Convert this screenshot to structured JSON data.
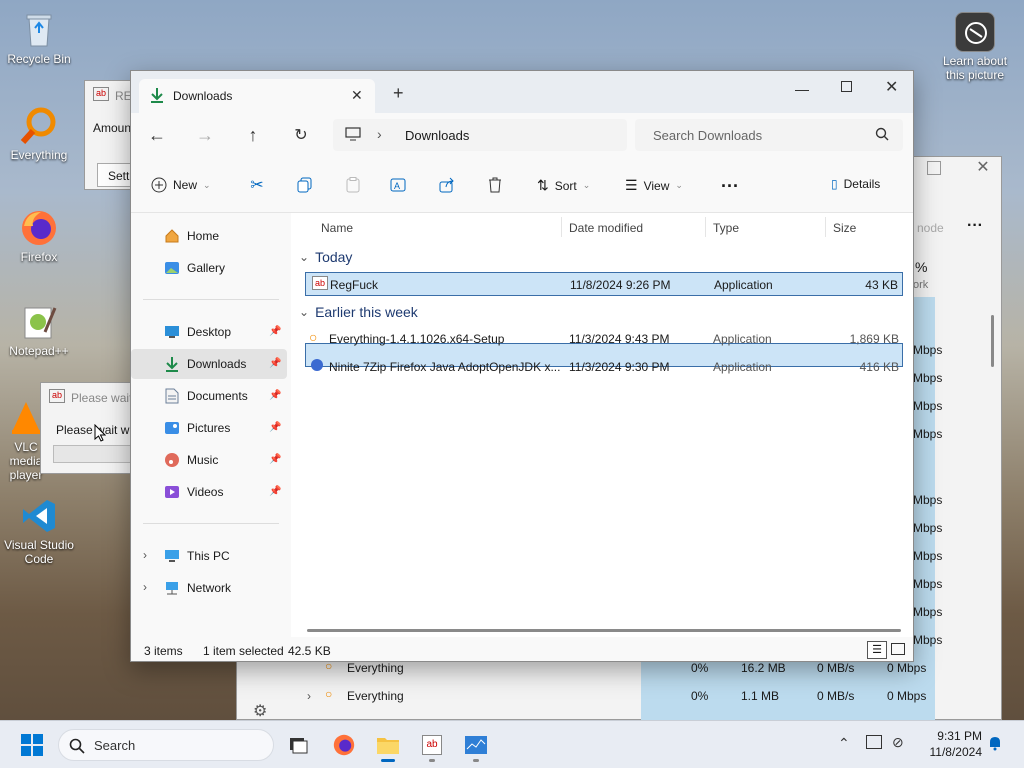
{
  "desktop": {
    "icons": [
      {
        "label": "Recycle Bin"
      },
      {
        "label": "Everything"
      },
      {
        "label": "Firefox"
      },
      {
        "label": "Notepad++"
      },
      {
        "label": "VLC media player"
      },
      {
        "label": "Visual Studio Code"
      }
    ],
    "learn_label": "Learn about this picture"
  },
  "bg_windows": {
    "regfuck_title": "RE",
    "amount_label": "Amount",
    "settings_btn": "Setti",
    "please_wait_title": "Please wait",
    "please_wait_text": "Please wait whi",
    "task_mgr": {
      "mode_text": "node",
      "percent": "%",
      "work": "ork",
      "mbps_rows": [
        "Mbps",
        "Mbps",
        "Mbps",
        "Mbps",
        "Mbps",
        "Mbps",
        "Mbps",
        "Mbps",
        "Mbps",
        "Mbps",
        "Mbps"
      ],
      "rows": [
        {
          "name": "Everything",
          "cpu": "0%",
          "mem": "16.2 MB",
          "disk": "0 MB/s",
          "net": "0 Mbps"
        },
        {
          "name": "Everything",
          "cpu": "0%",
          "mem": "1.1 MB",
          "disk": "0 MB/s",
          "net": "0 Mbps"
        }
      ]
    }
  },
  "explorer": {
    "tab_title": "Downloads",
    "breadcrumb": "Downloads",
    "search_placeholder": "Search Downloads",
    "cmd": {
      "new": "New",
      "sort": "Sort",
      "view": "View",
      "more": "...",
      "details": "Details"
    },
    "sidebar": {
      "home": "Home",
      "gallery": "Gallery",
      "desktop": "Desktop",
      "downloads": "Downloads",
      "documents": "Documents",
      "pictures": "Pictures",
      "music": "Music",
      "videos": "Videos",
      "thispc": "This PC",
      "network": "Network"
    },
    "columns": {
      "name": "Name",
      "date": "Date modified",
      "type": "Type",
      "size": "Size"
    },
    "groups": {
      "today": "Today",
      "earlier": "Earlier this week"
    },
    "files_today": [
      {
        "name": "RegFuck",
        "date": "11/8/2024 9:26 PM",
        "type": "Application",
        "size": "43 KB"
      }
    ],
    "files_earlier": [
      {
        "name": "Everything-1.4.1.1026.x64-Setup",
        "date": "11/3/2024 9:43 PM",
        "type": "Application",
        "size": "1,869 KB"
      },
      {
        "name": "Ninite 7Zip Firefox Java AdoptOpenJDK x...",
        "date": "11/3/2024 9:30 PM",
        "type": "Application",
        "size": "416 KB"
      }
    ],
    "status": {
      "items": "3 items",
      "selected": "1 item selected",
      "size": "42.5 KB"
    }
  },
  "taskbar": {
    "search_label": "Search",
    "time": "9:31 PM",
    "date": "11/8/2024"
  },
  "colors": {
    "accent": "#0067c0",
    "selected_bg": "#cce4f7"
  }
}
